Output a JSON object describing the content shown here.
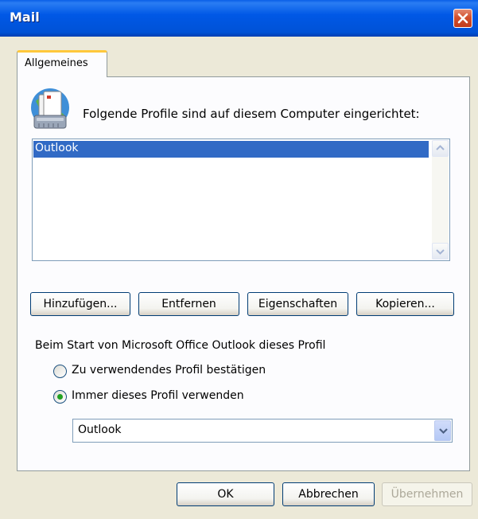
{
  "window": {
    "title": "Mail"
  },
  "tabs": [
    {
      "label": "Allgemeines"
    }
  ],
  "profiles": {
    "heading": "Folgende Profile sind auf diesem Computer eingerichtet:",
    "items": [
      {
        "label": "Outlook",
        "selected": true
      }
    ]
  },
  "profile_buttons": {
    "add": "Hinzufügen...",
    "remove": "Entfernen",
    "properties": "Eigenschaften",
    "copy": "Kopieren..."
  },
  "startup": {
    "label": "Beim Start von Microsoft Office Outlook dieses Profil",
    "option_confirm": "Zu verwendendes Profil bestätigen",
    "option_always": "Immer dieses Profil verwenden",
    "selected_option": "option_always",
    "profile_select_value": "Outlook"
  },
  "footer": {
    "ok": "OK",
    "cancel": "Abbrechen",
    "apply": "Übernehmen"
  },
  "colors": {
    "titlebar": "#0055e5",
    "selection": "#316ac5",
    "tab_highlight": "#ffc83c",
    "radio_dot": "#21a121",
    "close_button": "#d2502e"
  },
  "icons": {
    "profiles_icon": "mail-profiles-icon",
    "close_icon": "close-icon",
    "scroll_up": "scroll-up-icon",
    "scroll_down": "scroll-down-icon",
    "dropdown": "chevron-down-icon"
  }
}
